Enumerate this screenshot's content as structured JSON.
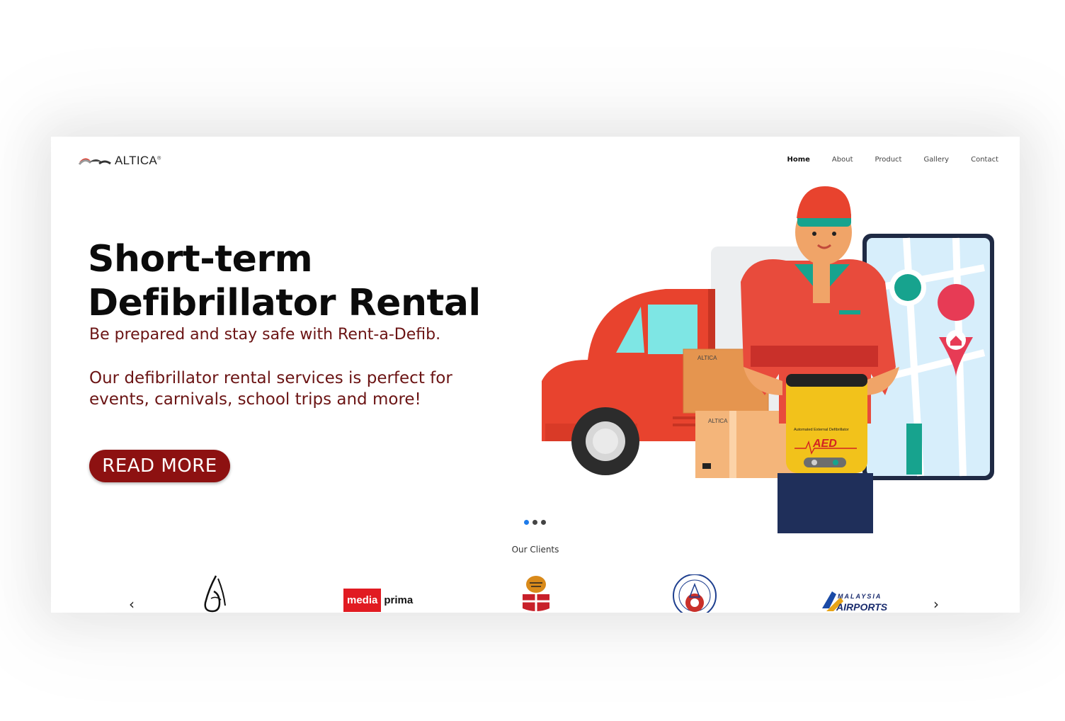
{
  "header": {
    "logo_text": "ALTICA",
    "nav": [
      {
        "label": "Home",
        "active": true
      },
      {
        "label": "About"
      },
      {
        "label": "Product"
      },
      {
        "label": "Gallery"
      },
      {
        "label": "Contact"
      }
    ]
  },
  "hero": {
    "title_line1": "Short-term",
    "title_line2": "Defibrillator Rental",
    "subtitle": "Be prepared and stay safe with Rent-a-Defib.",
    "description_line1": "Our defibrillator rental services is perfect for",
    "description_line2": "events, carnivals, school trips and more!",
    "cta_label": "READ MORE",
    "illustration": {
      "box_label": "ALTICA",
      "aed_caption": "Automated External Defibrillator",
      "aed_label": "AED"
    }
  },
  "carousel": {
    "slides": 3,
    "active_index": 0
  },
  "clients": {
    "title": "Our Clients",
    "prev_icon": "chevron-left-icon",
    "next_icon": "chevron-right-icon",
    "logos": [
      {
        "name": "calligraphy-emblem"
      },
      {
        "name": "media-prima",
        "text_a": "media",
        "text_b": "prima"
      },
      {
        "name": "tiger-crest"
      },
      {
        "name": "majlis-amanah-rakyat-seal"
      },
      {
        "name": "malaysia-airports",
        "text_a": "MALAYSIA",
        "text_b": "AIRPORTS"
      }
    ]
  },
  "colors": {
    "accent": "#8d1111",
    "text_dark": "#0b0b0b",
    "subtitle": "#6b1414",
    "dot_active": "#1e7bea"
  }
}
